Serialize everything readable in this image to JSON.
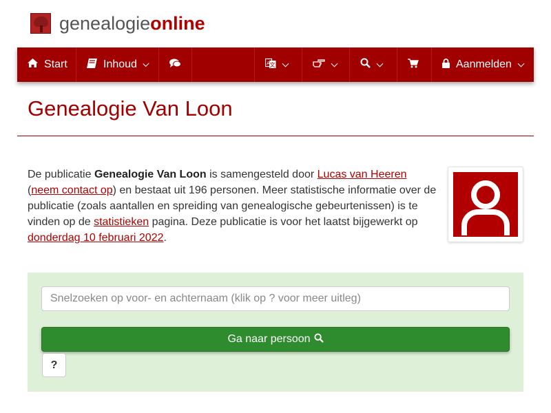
{
  "logo": {
    "text_light": "genealogie",
    "text_bold": "online"
  },
  "navbar": {
    "start": "Start",
    "inhoud": "Inhoud",
    "login": "Aanmelden"
  },
  "page": {
    "title": "Genealogie Van Loon"
  },
  "intro": {
    "p1": "De publicatie ",
    "pub_name": "Genealogie Van Loon",
    "p2": " is samengesteld door ",
    "author": "Lucas van Heeren",
    "p3": "(",
    "contact": "neem contact op",
    "p4": ") en bestaat uit 196 personen. Meer statistische informatie over de publicatie (zoals aantallen en spreiding van genealogische gebeurtenissen) is te vinden op de ",
    "stats": "statistieken",
    "p5": " pagina. Deze publicatie is voor het laatst bijgewerkt op ",
    "updated": "donderdag 10 februari 2022",
    "p6": "."
  },
  "search": {
    "placeholder": "Snelzoeken op voor- en achternaam (klik op ? voor meer uitleg)",
    "go_label": "Ga naar persoon",
    "help_label": "?"
  },
  "colors": {
    "brand": "#a00000",
    "panel": "#dff0d8",
    "go": "#2e8b2e"
  },
  "icons": [
    "home-icon",
    "book-icon",
    "comments-icon",
    "translate-icon",
    "hand-point-icon",
    "search-icon",
    "cart-icon",
    "lock-icon",
    "user-icon",
    "chevron-down-icon"
  ]
}
